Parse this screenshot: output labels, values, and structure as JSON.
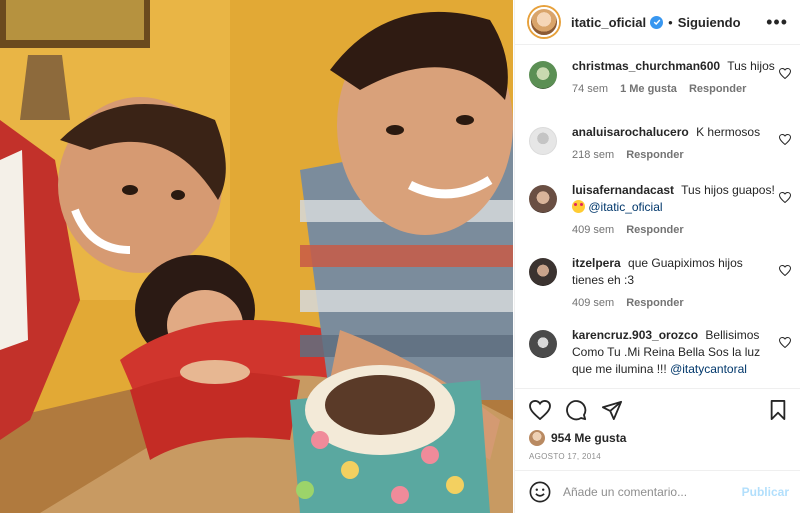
{
  "post": {
    "photo_alt": "",
    "author": "itatic_oficial",
    "separator": "•",
    "follow_state": "Siguiendo",
    "more_glyph": "•••"
  },
  "comments": [
    {
      "user": "christmas_churchman600",
      "text": "Tus hijos",
      "mention": "",
      "time": "74 sem",
      "likes": "1 Me gusta",
      "reply": "Responder",
      "avatar_color": "#5b8f54"
    },
    {
      "user": "analuisarochalucero",
      "text": "K hermosos",
      "mention": "",
      "time": "218 sem",
      "likes": "",
      "reply": "Responder",
      "avatar_color": "#d8d8d8"
    },
    {
      "user": "luisafernandacast",
      "text": "Tus hijos guapos!",
      "mention": "@itatic_oficial",
      "time": "409 sem",
      "likes": "",
      "reply": "Responder",
      "avatar_color": "#6a4f43"
    },
    {
      "user": "itzelpera",
      "text": "que Guapiximos hijos tienes eh :3",
      "mention": "",
      "time": "409 sem",
      "likes": "",
      "reply": "Responder",
      "avatar_color": "#3b3330"
    },
    {
      "user": "karencruz.903_orozco",
      "text": "Bellisimos Como Tu .Mi Reina Bella Sos la luz que me ilumina !!!",
      "mention": "@itatycantoral",
      "time": "",
      "likes": "",
      "reply": "",
      "avatar_color": "#4a4a4a"
    }
  ],
  "actions": {
    "likes_count": "954 Me gusta",
    "date": "AGOSTO 17, 2014"
  },
  "composer": {
    "placeholder": "Añade un comentario...",
    "publish_label": "Publicar"
  },
  "colors": {
    "accent": "#0095f6",
    "publish_disabled": "#b2dffc",
    "muted": "#737373",
    "verified": "#3897f0"
  }
}
